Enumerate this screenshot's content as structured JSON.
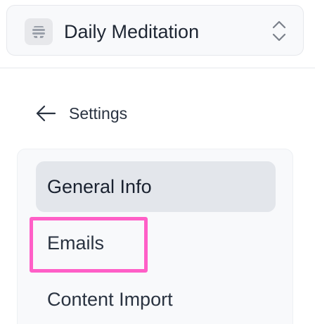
{
  "workspace": {
    "name": "Daily Meditation",
    "logo_icon": "beehive-icon",
    "switcher_icon": "chevron-up-down-icon"
  },
  "back_link": {
    "icon": "arrow-left-icon",
    "label": "Settings"
  },
  "settings_nav": {
    "items": [
      {
        "label": "General Info",
        "active": true
      },
      {
        "label": "Emails",
        "active": false,
        "highlighted": true
      },
      {
        "label": "Content Import",
        "active": false
      }
    ]
  },
  "colors": {
    "highlight": "#ff5fc7",
    "active_item_bg": "#e3e6eb",
    "panel_bg": "#f8f9fb",
    "text": "#2a3341"
  }
}
